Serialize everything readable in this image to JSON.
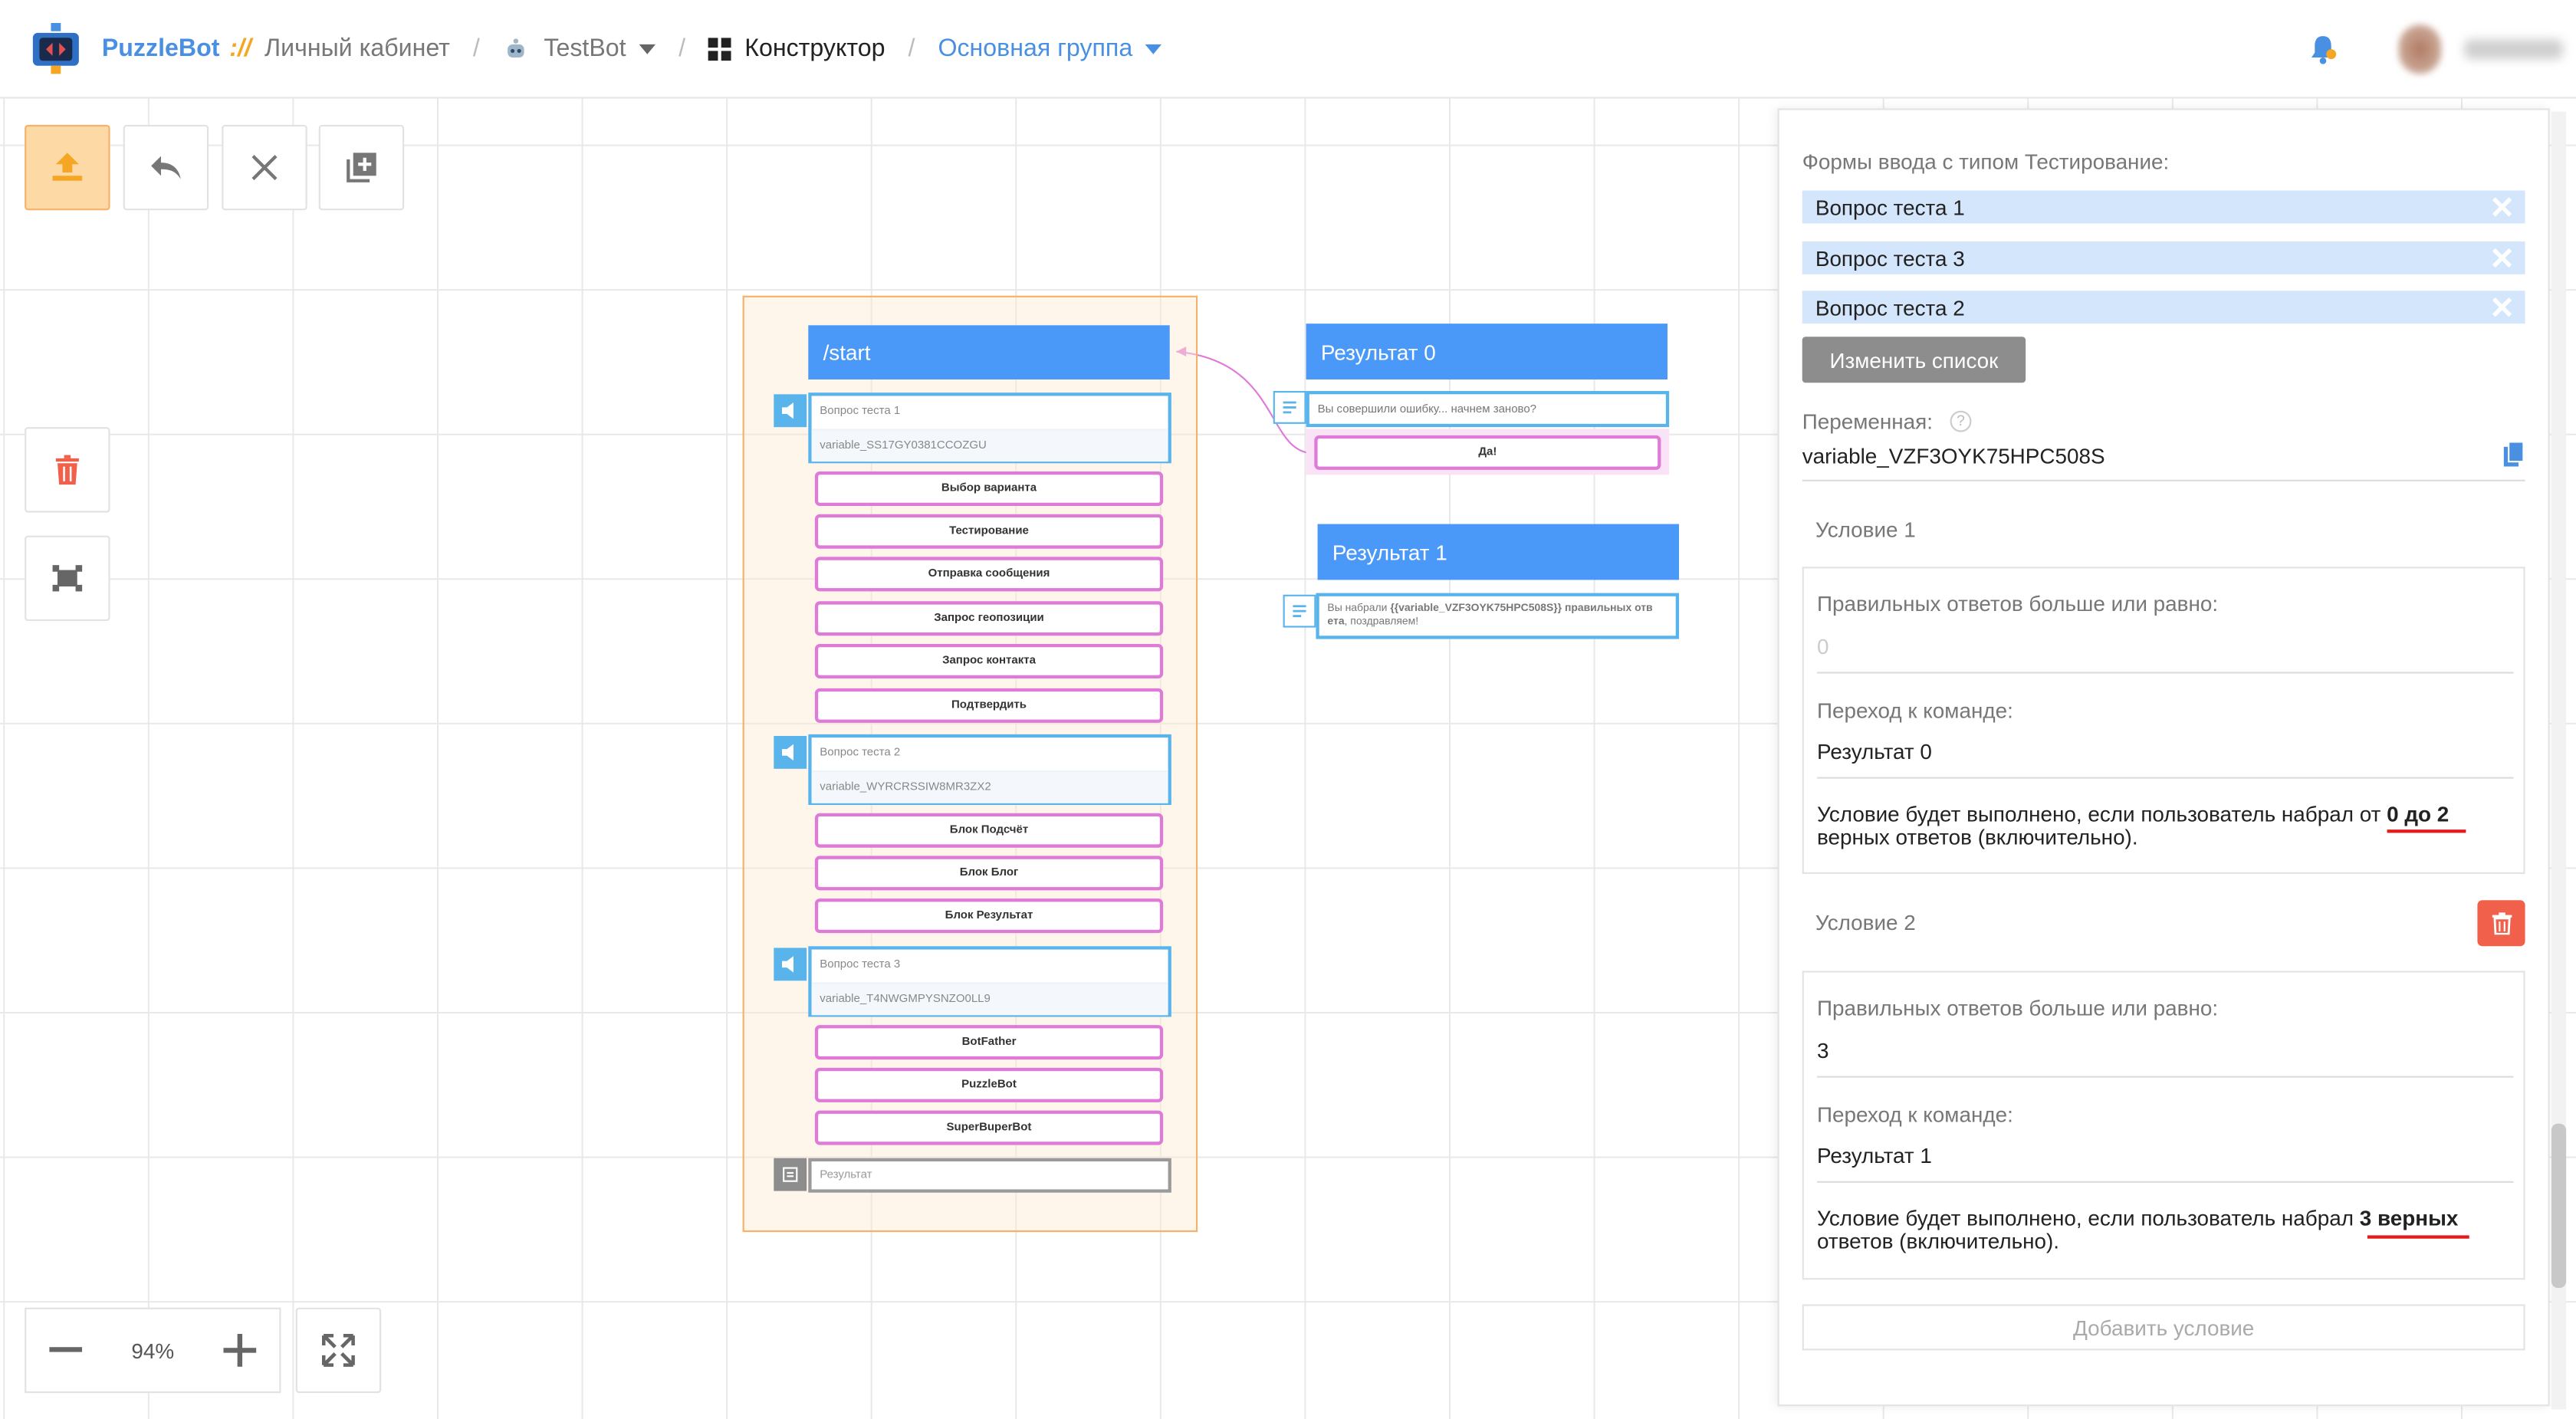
{
  "header": {
    "brand": "PuzzleBot",
    "brand_sep": "://",
    "cabinet": "Личный кабинет",
    "bot": "TestBot",
    "constructor": "Конструктор",
    "group": "Основная группа"
  },
  "toolbar": {
    "upload_icon": "upload-icon",
    "undo_icon": "undo-icon",
    "close_icon": "close-icon",
    "add_icon": "add-block-icon",
    "delete_icon": "trash-icon",
    "select_icon": "select-area-icon"
  },
  "zoom": {
    "value": "94%"
  },
  "canvas": {
    "start_cmd": "/start",
    "q1_title": "Вопрос теста 1",
    "q1_var": "variable_SS17GY0381CCOZGU",
    "q1_options": [
      "Выбор варианта",
      "Тестирование",
      "Отправка сообщения",
      "Запрос геопозиции",
      "Запрос контакта",
      "Подтвердить"
    ],
    "q2_title": "Вопрос теста 2",
    "q2_var": "variable_WYRCRSSIW8MR3ZX2",
    "q2_options": [
      "Блок Подсчёт",
      "Блок Блог",
      "Блок Результат"
    ],
    "q3_title": "Вопрос теста 3",
    "q3_var": "variable_T4NWGMPYSNZO0LL9",
    "q3_options": [
      "BotFather",
      "PuzzleBot",
      "SuperBuperBot"
    ],
    "result_box": "Результат",
    "r0_title": "Результат 0",
    "r0_msg": "Вы совершили ошибку... начнем заново?",
    "r0_btn": "Да!",
    "r1_title": "Результат 1",
    "r1_msg_a": "Вы набрали",
    "r1_msg_b": "{{variable_VZF3OYK75HPC508S}} правильных отв",
    "r1_msg_c": "ета",
    "r1_msg_d": ", поздравляем!"
  },
  "panel": {
    "forms_label": "Формы ввода с типом Тестирование:",
    "chips": [
      "Вопрос теста 1",
      "Вопрос теста 3",
      "Вопрос теста 2"
    ],
    "edit_list": "Изменить список",
    "var_label": "Переменная:",
    "var_value": "variable_VZF3OYK75HPC508S",
    "cond1_title": "Условие  1",
    "cond1_min_label": "Правильных ответов больше или равно:",
    "cond1_min_value": "0",
    "cond1_goto_label": "Переход к команде:",
    "cond1_goto_value": "Результат 0",
    "cond1_note_a": "Условие будет выполнено, если пользователь набрал от ",
    "cond1_note_b": "0 до 2",
    "cond1_note_c": "верных ответов (включительно).",
    "cond2_title": "Условие  2",
    "cond2_min_label": "Правильных ответов больше или равно:",
    "cond2_min_value": "3",
    "cond2_goto_label": "Переход к команде:",
    "cond2_goto_value": "Результат 1",
    "cond2_note_a": "Условие будет выполнено, если пользователь набрал ",
    "cond2_note_b": "3 верных",
    "cond2_note_c": "ответов (включительно).",
    "add_condition": "Добавить условие"
  },
  "colors": {
    "accent": "#4a99f8",
    "orange": "#f5a623",
    "option_border": "#e07ad8",
    "red": "#e31b1b"
  }
}
